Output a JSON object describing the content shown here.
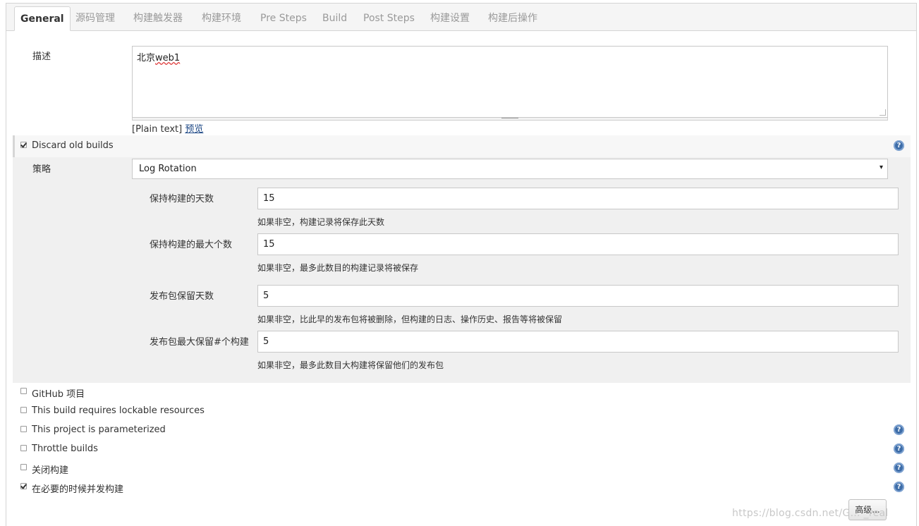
{
  "tabs": [
    {
      "label": "General",
      "active": true
    },
    {
      "label": "源码管理"
    },
    {
      "label": "构建触发器"
    },
    {
      "label": "构建环境"
    },
    {
      "label": "Pre Steps"
    },
    {
      "label": "Build"
    },
    {
      "label": "Post Steps"
    },
    {
      "label": "构建设置"
    },
    {
      "label": "构建后操作"
    }
  ],
  "description": {
    "label": "描述",
    "value_prefix": "北京",
    "value_misspelled": "web1",
    "plain_text": "[Plain text]",
    "preview_link": "预览"
  },
  "discard": {
    "label": "Discard old builds",
    "checked": true,
    "strategy_label": "策略",
    "strategy_value": "Log Rotation",
    "fields": [
      {
        "label": "保持构建的天数",
        "value": "15",
        "hint": "如果非空，构建记录将保存此天数"
      },
      {
        "label": "保持构建的最大个数",
        "value": "15",
        "hint": "如果非空，最多此数目的构建记录将被保存"
      },
      {
        "label": "发布包保留天数",
        "value": "5",
        "hint": "如果非空，比此早的发布包将被删除，但构建的日志、操作历史、报告等将被保留"
      },
      {
        "label": "发布包最大保留#个构建",
        "value": "5",
        "hint": "如果非空，最多此数目大构建将保留他们的发布包"
      }
    ]
  },
  "options": [
    {
      "label": "GitHub 项目",
      "checked": false,
      "help": false
    },
    {
      "label": "This build requires lockable resources",
      "checked": false,
      "help": false
    },
    {
      "label": "This project is parameterized",
      "checked": false,
      "help": true
    },
    {
      "label": "Throttle builds",
      "checked": false,
      "help": true
    },
    {
      "label": "关闭构建",
      "checked": false,
      "help": true
    },
    {
      "label": "在必要的时候并发构建",
      "checked": true,
      "help": true
    }
  ],
  "advanced_button": "高级...",
  "help_glyph": "?",
  "select_arrow": "▾",
  "watermark": "https://blog.csdn.net/G… _real",
  "colors": {
    "help_icon": "#3e6da8",
    "link": "#204a87",
    "section_bg": "#f0f0f0"
  }
}
